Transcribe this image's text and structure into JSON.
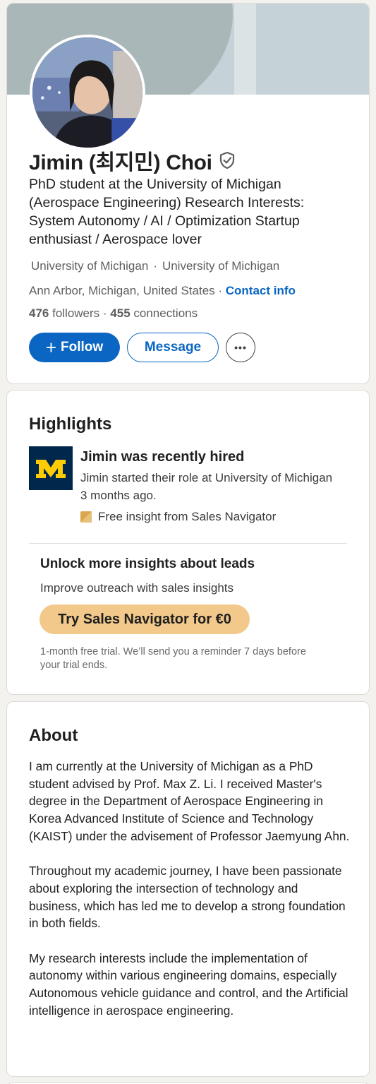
{
  "profile": {
    "name": "Jimin (최지민) Choi",
    "headline": "PhD student at the University of Michigan (Aerospace Engineering) Research Interests: System Autonomy / AI / Optimization Startup enthusiast / Aerospace lover",
    "education_1": "University of Michigan",
    "separator": "·",
    "education_2": "University of Michigan",
    "location": "Ann Arbor, Michigan, United States",
    "location_sep": " · ",
    "contact_label": "Contact info",
    "followers_count": "476",
    "followers_label": " followers",
    "connections_sep": " · ",
    "connections_count": "455",
    "connections_label": " connections",
    "follow_plus": "+",
    "follow_label": "Follow",
    "message_label": "Message",
    "more_label": "•••"
  },
  "highlights": {
    "title": "Highlights",
    "hired_title": "Jimin was recently hired",
    "hired_desc": "Jimin started their role at University of Michigan 3 months ago.",
    "insight_label": "Free insight from Sales Navigator",
    "unlock_title": "Unlock more insights about leads",
    "unlock_sub": "Improve outreach with sales insights",
    "cta_label": "Try Sales Navigator for €0",
    "trial_note": "1-month free trial. We’ll send you a reminder 7 days before your trial ends."
  },
  "about": {
    "title": "About",
    "paragraphs": [
      "I am currently at the University of Michigan as a PhD student advised by Prof. Max Z. Li. I received Master's degree in the Department of Aerospace Engineering in Korea Advanced Institute of Science and Technology (KAIST) under the advisement of Professor Jaemyung Ahn.",
      "Throughout my academic journey, I have been passionate about exploring the intersection of technology and business, which has led me to develop a strong foundation in both fields.",
      "My research interests include the implementation of autonomy within various engineering domains, especially Autonomous vehicle guidance and control, and the Artificial intelligence in aerospace engineering."
    ]
  },
  "icons": {
    "verified": "verified-shield-icon",
    "logo": "university-of-michigan-logo",
    "insight": "sales-navigator-icon",
    "more": "ellipsis-icon"
  },
  "colors": {
    "brand_blue": "#0a66c2",
    "sales_gold": "#f2c98a",
    "michigan_blue": "#00274c",
    "michigan_maize": "#ffcb05"
  }
}
